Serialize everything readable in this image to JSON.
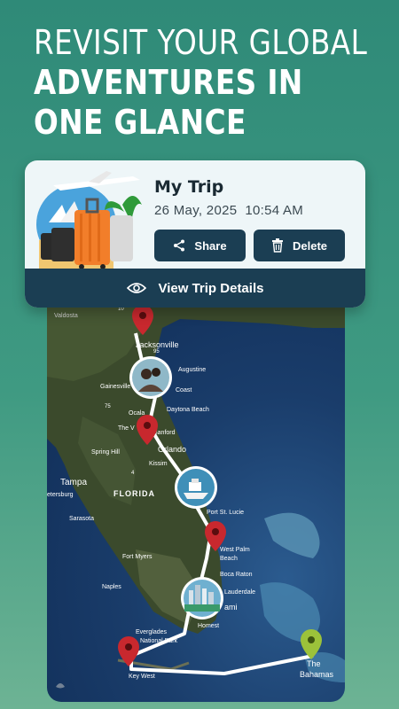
{
  "headline": {
    "line1": "REVISIT YOUR GLOBAL",
    "line2": "ADVENTURES IN",
    "line3": "ONE GLANCE"
  },
  "trip_card": {
    "title": "My Trip",
    "date": "26 May, 2025",
    "time": "10:54 AM",
    "share_label": "Share",
    "delete_label": "Delete",
    "view_details_label": "View Trip Details",
    "icons": {
      "share": "share-icon",
      "delete": "trash-icon",
      "view": "eye-icon",
      "thumbnail": "travel-illustration"
    }
  },
  "map": {
    "labels": {
      "valdosta": "Valdosta",
      "jacksonville": "Jacksonville",
      "gainesville": "Gainesville",
      "augustine": "Augustine",
      "coast": "Coast",
      "ocala": "Ocala",
      "daytona": "Daytona Beach",
      "the_villages": "The V",
      "sanford": "Sanford",
      "orlando": "Orlando",
      "kissimmee": "Kissim",
      "spring_hill": "Spring Hill",
      "tampa": "Tampa",
      "petersburg": "etersburg",
      "florida": "FLORIDA",
      "sarasota": "Sarasota",
      "port_st_lucie": "Port St. Lucie",
      "west_palm": "West Palm",
      "beach": "Beach",
      "fort_myers": "Fort Myers",
      "boca_raton": "Boca Raton",
      "naples": "Naples",
      "lauderdale": "Lauderdale",
      "miami": "ami",
      "homestead": "Homest",
      "national_park": "National Park",
      "everglades": "Everglades",
      "key_west": "Key West",
      "the_bahamas_1": "The",
      "the_bahamas_2": "Bahamas",
      "r75": "75",
      "r95": "95",
      "r4": "4",
      "r10": "10"
    },
    "pins": [
      "red",
      "red",
      "red",
      "red",
      "green"
    ],
    "photo_pins": [
      "selfie-photo",
      "boat-photo",
      "city-photo"
    ],
    "colors": {
      "pin_red": "#c8282e",
      "pin_green": "#9cc23a",
      "route": "#ffffff",
      "land": "#3e4a2e",
      "ocean": "#1a3d6b"
    }
  }
}
